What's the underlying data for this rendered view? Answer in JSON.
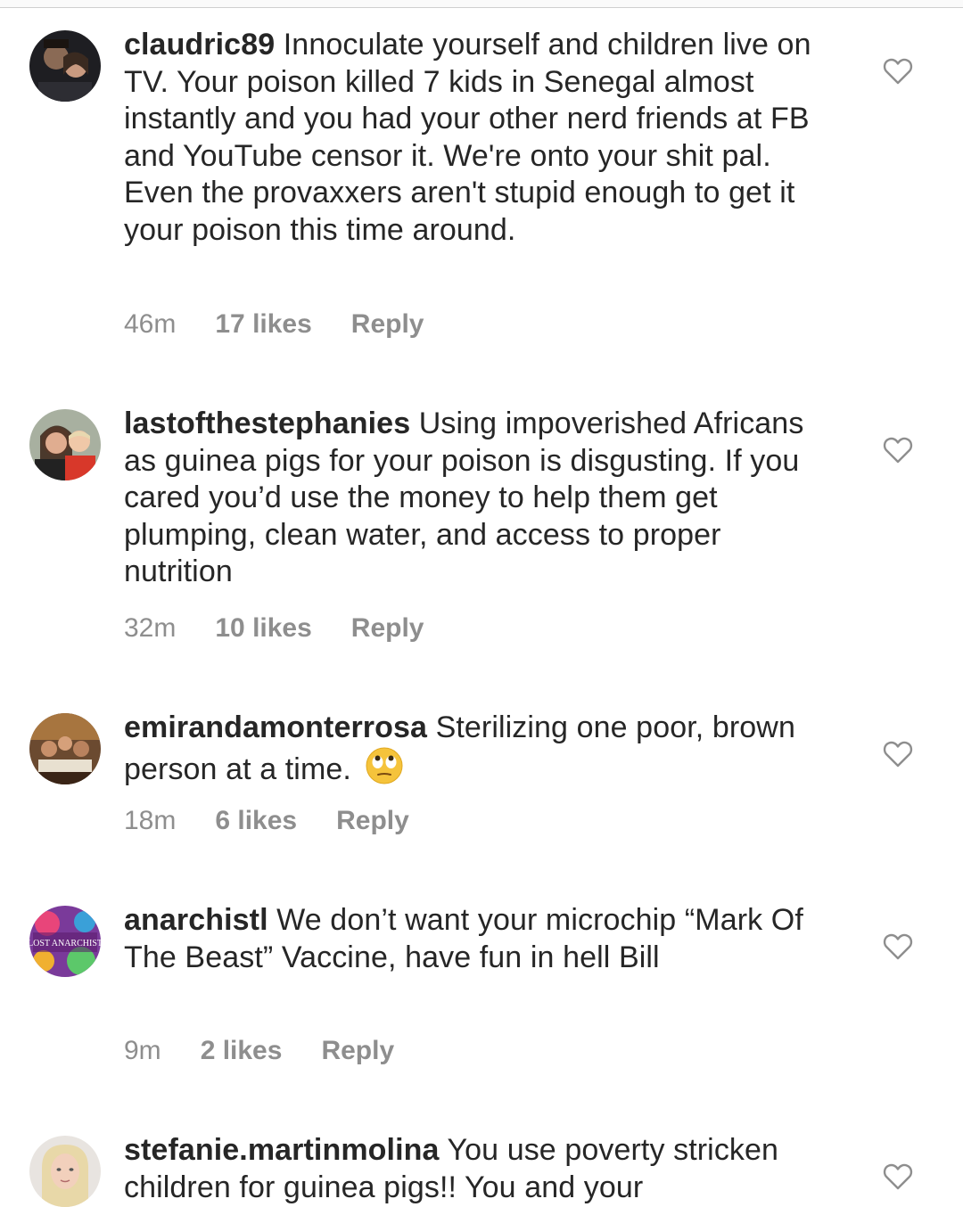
{
  "comments": [
    {
      "username": "claudric89",
      "text": "Innoculate yourself and children live on TV. Your poison killed 7 kids in Senegal almost instantly and you had your other nerd friends at FB and YouTube censor it. We're onto your shit pal. Even the provaxxers aren't stupid enough to get it your poison this time around.",
      "time": "46m",
      "likes": "17 likes",
      "reply": "Reply"
    },
    {
      "username": "lastofthestephanies",
      "text": "Using impoverished Africans as guinea pigs for your poison is disgusting. If you cared you’d use the money to help them get plumping, clean water, and access to proper nutrition",
      "time": "32m",
      "likes": "10 likes",
      "reply": "Reply"
    },
    {
      "username": "emirandamonterrosa",
      "text": "Sterilizing one poor, brown person at a time.",
      "emoji": "face-with-rolling-eyes",
      "time": "18m",
      "likes": "6 likes",
      "reply": "Reply"
    },
    {
      "username": "anarchistl",
      "text": "We don’t want your microchip “Mark Of The Beast” Vaccine, have fun in hell Bill",
      "avatar_text": "LOST ANARCHIST",
      "time": "9m",
      "likes": "2 likes",
      "reply": "Reply"
    },
    {
      "username": "stefanie.martinmolina",
      "text": "You use poverty stricken children for guinea pigs!! You and your"
    }
  ],
  "icons": {
    "like": "heart-outline-icon"
  },
  "colors": {
    "text": "#262626",
    "meta": "#8e8e8e",
    "heart": "#8e8e8e"
  }
}
